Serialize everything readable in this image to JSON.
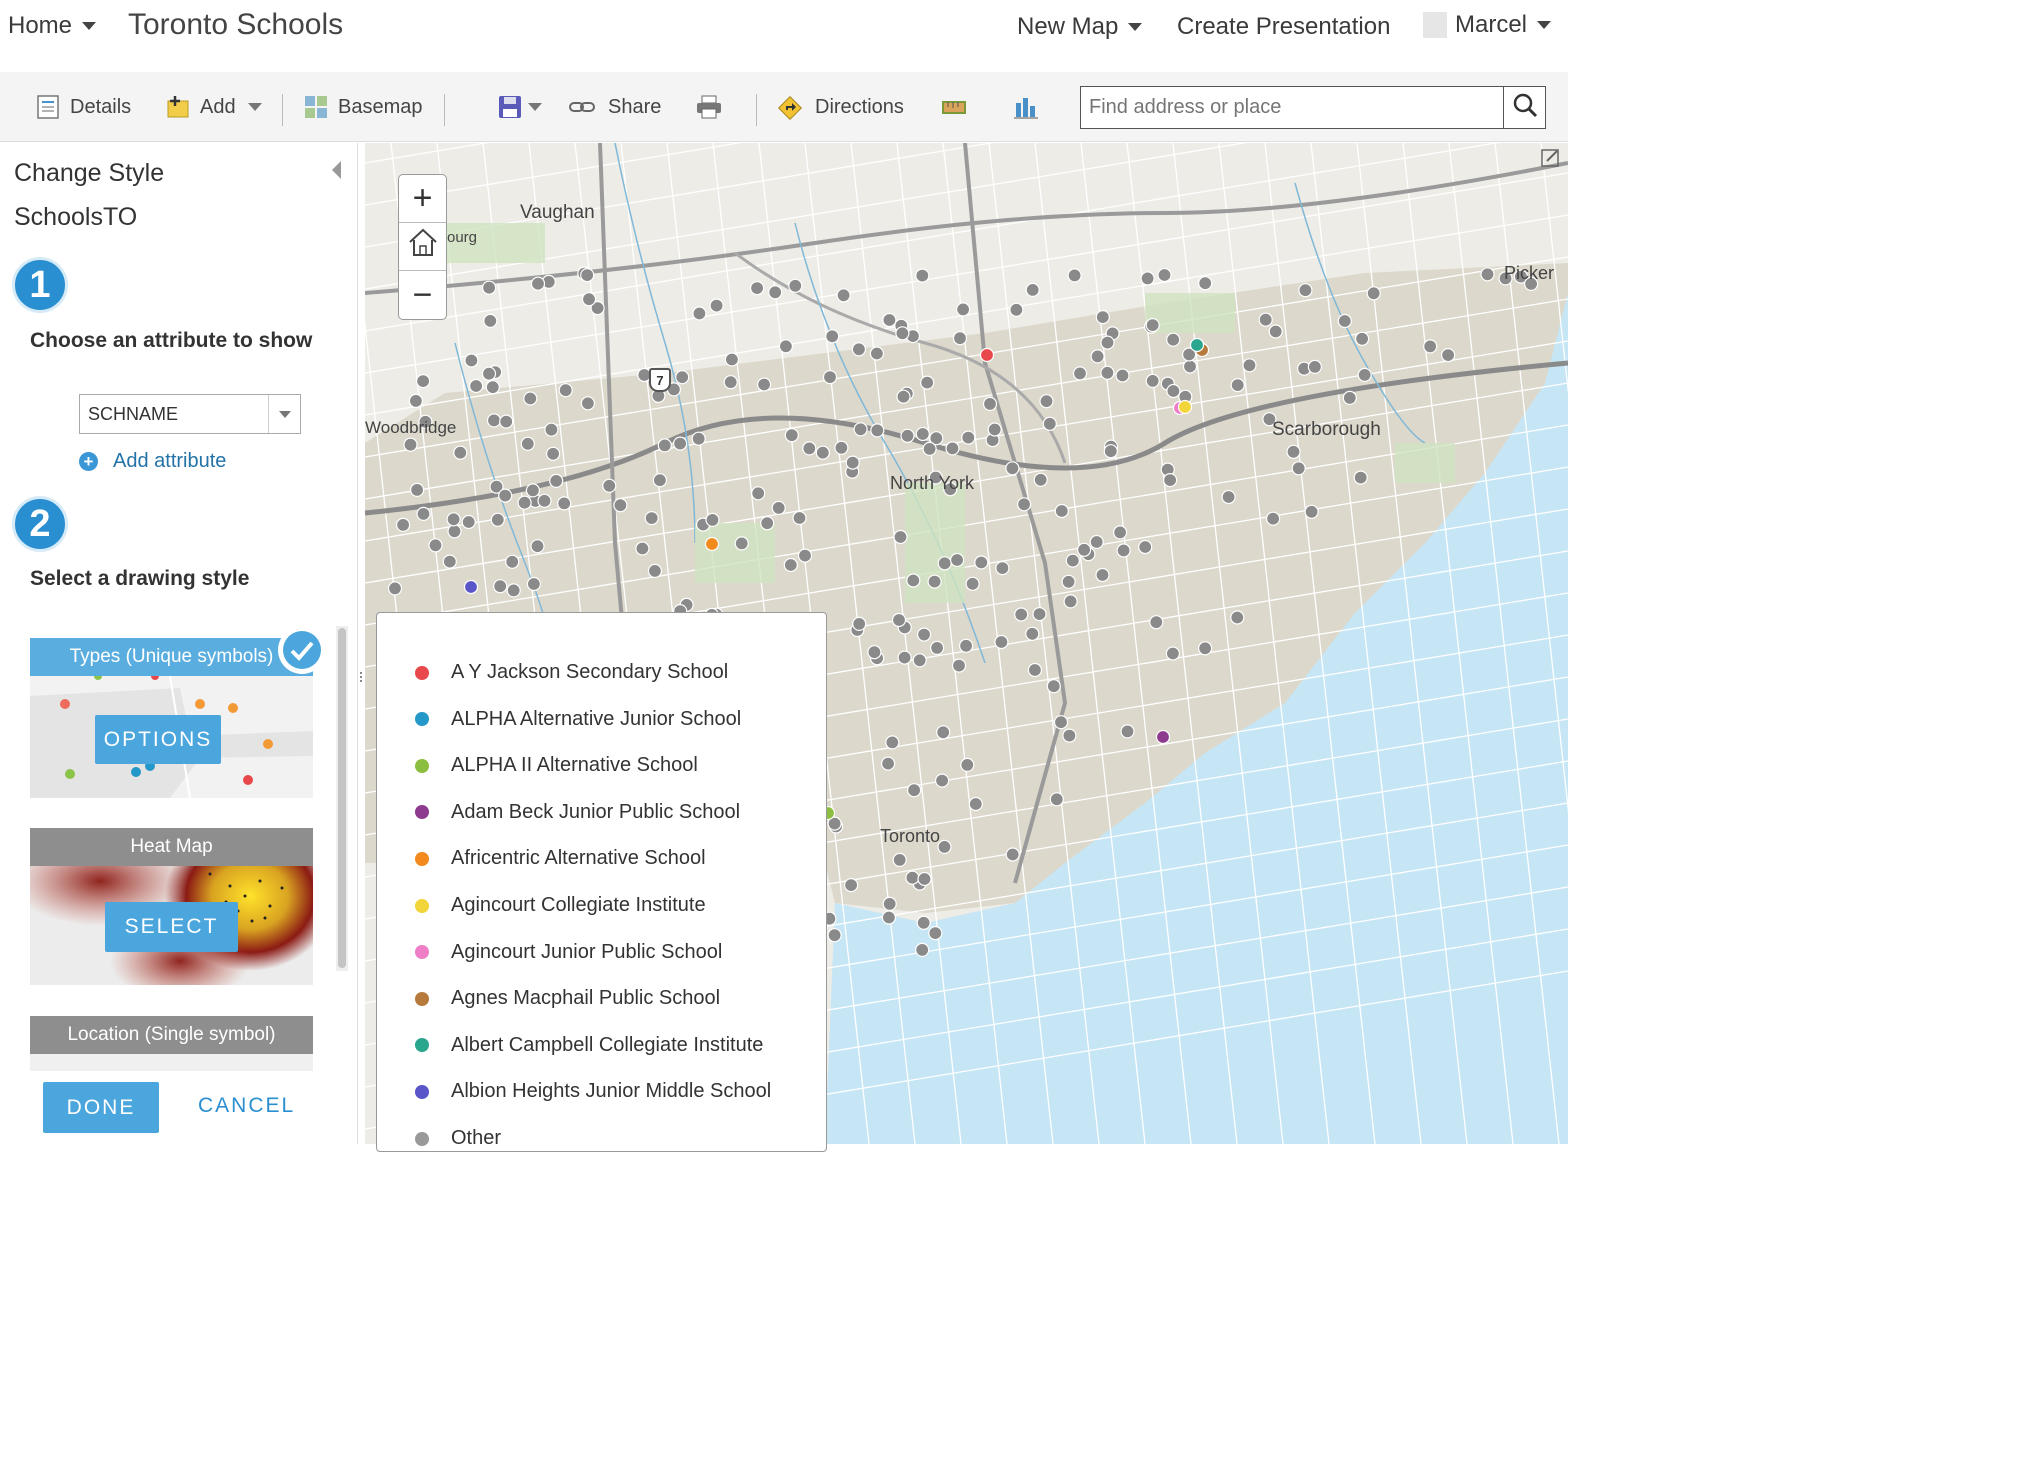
{
  "header": {
    "home_label": "Home",
    "title": "Toronto Schools",
    "new_map_label": "New Map",
    "create_presentation_label": "Create Presentation",
    "user_name": "Marcel"
  },
  "toolbar": {
    "details_label": "Details",
    "add_label": "Add",
    "basemap_label": "Basemap",
    "share_label": "Share",
    "directions_label": "Directions",
    "search_placeholder": "Find address or place"
  },
  "panel": {
    "heading": "Change Style",
    "layer_name": "SchoolsTO",
    "step1_number": "1",
    "step1_title": "Choose an attribute to show",
    "attribute_value": "SCHNAME",
    "add_attribute_label": "Add attribute",
    "step2_number": "2",
    "step2_title": "Select a drawing style",
    "styles": [
      {
        "title": "Types (Unique symbols)",
        "button": "OPTIONS",
        "selected": true
      },
      {
        "title": "Heat Map",
        "button": "SELECT",
        "selected": false
      },
      {
        "title": "Location (Single symbol)",
        "button": "",
        "selected": false
      }
    ],
    "done_label": "DONE",
    "cancel_label": "CANCEL"
  },
  "map": {
    "place_labels": [
      "Vaughan",
      "Woodbridge",
      "North York",
      "Scarborough",
      "Toronto",
      "Picker",
      "ourg"
    ],
    "highway_shield": "7"
  },
  "legend": {
    "items": [
      {
        "label": "A Y Jackson Secondary School",
        "color": "#e8474c"
      },
      {
        "label": "ALPHA Alternative Junior School",
        "color": "#2398c9"
      },
      {
        "label": "ALPHA II Alternative School",
        "color": "#8cbf3f"
      },
      {
        "label": "Adam Beck Junior Public School",
        "color": "#8e3a8f"
      },
      {
        "label": "Africentric Alternative School",
        "color": "#f28a1e"
      },
      {
        "label": "Agincourt Collegiate Institute",
        "color": "#f1d53a"
      },
      {
        "label": "Agincourt Junior Public School",
        "color": "#ee7fc6"
      },
      {
        "label": "Agnes Macphail Public School",
        "color": "#b77a3d"
      },
      {
        "label": "Albert Campbell Collegiate Institute",
        "color": "#2aa58e"
      },
      {
        "label": "Albion Heights Junior Middle School",
        "color": "#5a55c8"
      },
      {
        "label": "Other",
        "color": "#999999"
      }
    ]
  },
  "colors": {
    "accent": "#4aa6dc",
    "step_blue": "#2a8fd0",
    "water": "#c6e6f5",
    "urban": "#dcd8cc",
    "point_gray": "#8a8a8a"
  }
}
